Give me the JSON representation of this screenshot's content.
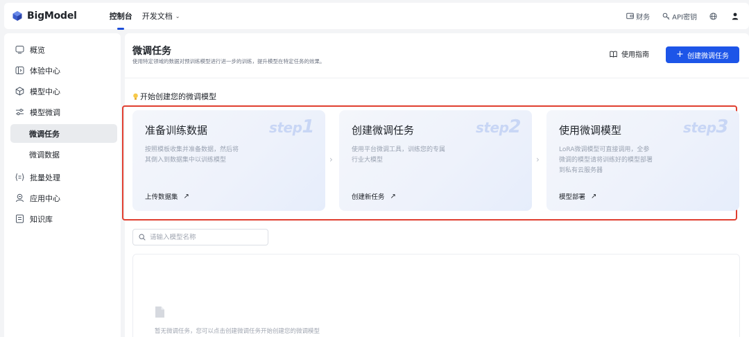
{
  "brand": {
    "name": "BigModel",
    "accent": "#1d55e8"
  },
  "top_nav": {
    "items": [
      {
        "label": "控制台",
        "active": true
      },
      {
        "label": "开发文档",
        "has_dropdown": true
      }
    ],
    "right": {
      "finance": "财务",
      "api_key": "API密钥"
    }
  },
  "sidebar": {
    "items": [
      {
        "label": "概览",
        "icon": "monitor-icon"
      },
      {
        "label": "体验中心",
        "icon": "code-panel-icon"
      },
      {
        "label": "模型中心",
        "icon": "cube-icon"
      },
      {
        "label": "模型微调",
        "icon": "sliders-icon"
      },
      {
        "label": "微调任务",
        "sub": true,
        "active": true
      },
      {
        "label": "微调数据",
        "sub": true
      },
      {
        "label": "批量处理",
        "icon": "braces-list-icon"
      },
      {
        "label": "应用中心",
        "icon": "robot-icon"
      },
      {
        "label": "知识库",
        "icon": "book-icon"
      }
    ]
  },
  "main": {
    "title": "微调任务",
    "subtitle": "使用特定领域的数据对预训练模型进行进一步的训练，提升模型在特定任务的效果。",
    "guide_label": "使用指南",
    "create_label": "创建微调任务",
    "section_title": "开始创建您的微调模型",
    "steps": [
      {
        "title": "准备训练数据",
        "tag": "step",
        "num": "1",
        "desc_lines": [
          "按照模板收集并准备数据，然后将",
          "其倒入到数据集中以训练模型"
        ],
        "link": "上传数据集"
      },
      {
        "title": "创建微调任务",
        "tag": "step",
        "num": "2",
        "desc_lines": [
          "使用平台微调工具，训练您的专属",
          "行业大模型"
        ],
        "link": "创建新任务"
      },
      {
        "title": "使用微调模型",
        "tag": "step",
        "num": "3",
        "desc_lines": [
          "LoRA微调模型可直接调用，全参",
          "微调的模型请将训练好的模型部署",
          "到私有云服务器"
        ],
        "link": "模型部署"
      }
    ],
    "search_placeholder": "请输入模型名称",
    "empty_text": "暂无微调任务，您可以点击创建微调任务开始创建您的微调模型"
  }
}
